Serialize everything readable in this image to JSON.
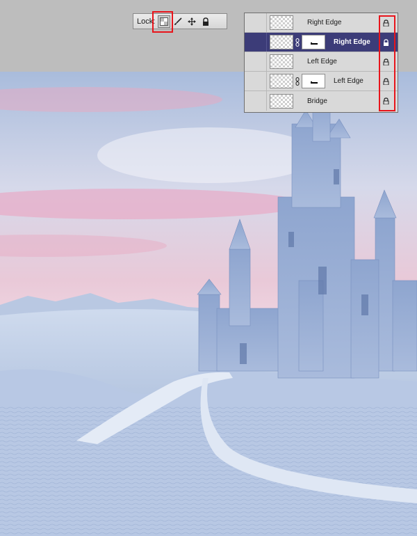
{
  "locks_bar": {
    "label": "Lock:",
    "buttons": [
      {
        "icon": "lock-transparent-pixels-icon",
        "pressed": true
      },
      {
        "icon": "brush-icon",
        "pressed": false
      },
      {
        "icon": "move-icon",
        "pressed": false
      },
      {
        "icon": "lock-all-icon",
        "pressed": false
      }
    ]
  },
  "layers": [
    {
      "name": "Right Edge",
      "selected": false,
      "has_mask": false,
      "locked": true
    },
    {
      "name": "Right Edge",
      "selected": true,
      "has_mask": true,
      "locked": true
    },
    {
      "name": "Left Edge",
      "selected": false,
      "has_mask": false,
      "locked": true
    },
    {
      "name": "Left Edge",
      "selected": false,
      "has_mask": true,
      "locked": true
    },
    {
      "name": "Bridge",
      "selected": false,
      "has_mask": false,
      "locked": true
    }
  ],
  "colors": {
    "highlight": "#e8141b",
    "selected_row": "#3c3c78",
    "toolbar_bg": "#dcdcdc"
  }
}
